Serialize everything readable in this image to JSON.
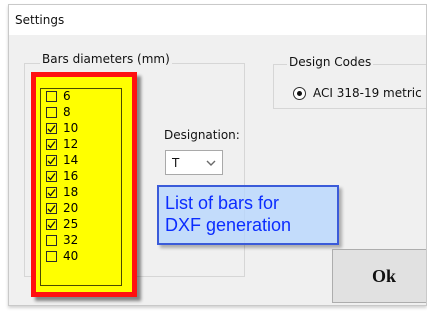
{
  "window": {
    "title": "Settings"
  },
  "bars_group": {
    "label": "Bars diameters (mm)",
    "items": [
      {
        "label": "6",
        "checked": false
      },
      {
        "label": "8",
        "checked": false
      },
      {
        "label": "10",
        "checked": true
      },
      {
        "label": "12",
        "checked": true
      },
      {
        "label": "14",
        "checked": true
      },
      {
        "label": "16",
        "checked": true
      },
      {
        "label": "18",
        "checked": true
      },
      {
        "label": "20",
        "checked": true
      },
      {
        "label": "25",
        "checked": true
      },
      {
        "label": "32",
        "checked": false
      },
      {
        "label": "40",
        "checked": false
      }
    ]
  },
  "designation": {
    "label": "Designation:",
    "selected": "T"
  },
  "callout": {
    "text": "List of bars for\nDXF generation"
  },
  "design_codes": {
    "label": "Design Codes",
    "option": "ACI 318-19 metric",
    "selected": true
  },
  "buttons": {
    "ok": "Ok"
  },
  "colors": {
    "highlight_fill": "#ffff00",
    "highlight_border": "#ff1010",
    "callout_text": "#0b2cff",
    "callout_border": "#3b5bd9"
  }
}
